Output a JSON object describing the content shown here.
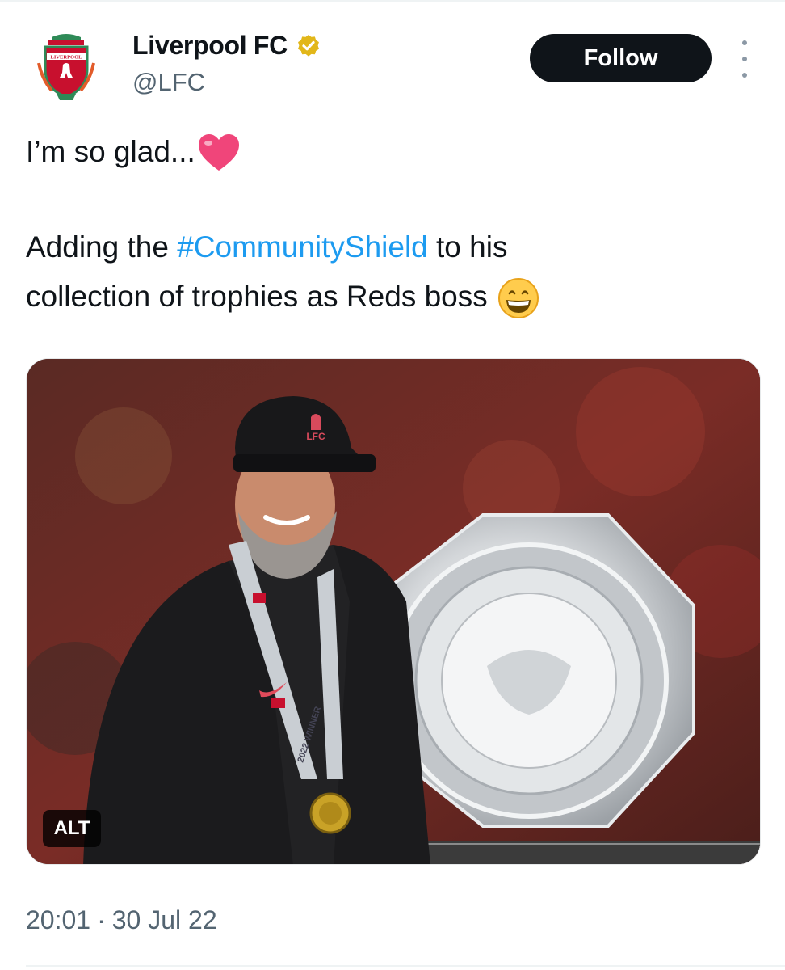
{
  "author": {
    "display_name": "Liverpool FC",
    "handle": "@LFC",
    "verified": true,
    "avatar_icon": "lfc-crest-icon",
    "crest_text": "LIVERPOOL"
  },
  "actions": {
    "follow_label": "Follow",
    "more_icon": "more-vertical-icon"
  },
  "tweet": {
    "line1_text": "I’m so glad...",
    "line1_emoji": "heart-emoji",
    "line2_before": "Adding the ",
    "hashtag": "#CommunityShield",
    "line2_after": " to his",
    "line3_text": "collection of trophies as Reds boss",
    "line3_emoji": "grinning-face-emoji"
  },
  "media": {
    "alt_label": "ALT",
    "cap_logo_text": "LFC",
    "medal_ribbon_text": "2022 WINNER"
  },
  "meta": {
    "time": "20:01",
    "separator": "·",
    "date": "30 Jul 22"
  },
  "colors": {
    "text": "#0f1419",
    "secondary": "#536471",
    "link": "#1d9bf0",
    "follow_bg": "#0f1419",
    "verified_gold": "#e2b719",
    "heart": "#f0457a"
  }
}
